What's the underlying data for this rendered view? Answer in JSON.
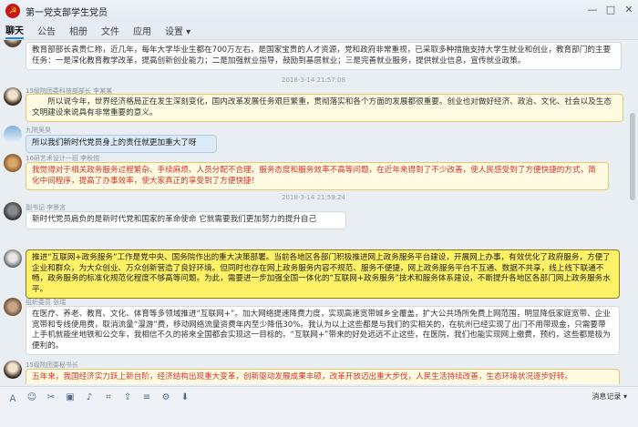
{
  "window": {
    "title": "第一党支部学生党员",
    "avatar_glyph": "☭",
    "controls": [
      "—",
      "□",
      "✕"
    ]
  },
  "tabs": [
    "聊天",
    "公告",
    "相册",
    "文件",
    "应用",
    "设置 ▾"
  ],
  "messages": [
    {
      "sender": "",
      "text": "教育部部长袁贵仁称，近几年，每年大学毕业生都在700万左右，是国家宝贵的人才资源，党和政府非常重视，已采取多种措施支持大学生就业和创业，教育部门的主要任务：一是深化教育教学改革，提高创新创业能力；二是加强就业指导，鼓励到基层就业；三是完善就业服务，提供就业信息，宣传就业政策。"
    },
    {
      "time": "2018-3-14 21:57:08"
    },
    {
      "sender": "15级院团委科技部部长 李某某",
      "text": "所以说今年，世界经济格局正在发生深刻变化，国内改革发展任务艰巨繁重，贯彻落实和各个方面的发展都很重要。创业也对做好经济、政治、文化、社会以及生态文明建设来说具有非常重要的意义。"
    },
    {
      "sender": "九院吴昊",
      "text": "所以我们新时代党员身上的责任就更加重大了呀"
    },
    {
      "sender": "16研艺术设计一班 李秋悦",
      "text": "我觉得对于相关政务服务过程繁杂、手续麻烦、人员分配不合理、服务态度和服务效率不高等问题，在近年来得到了不少改善，使人民感受到了方便快捷的方式，简化中间程序，提高了办事效率，使大家真正的享受到了方便快捷！"
    },
    {
      "time": "2018-3-14 21:59:24"
    },
    {
      "sender": "副书记 李景言",
      "text": "新时代党员肩负的是新时代党和国家的革命使命  它就需要我们更加努力的提升自己"
    },
    {
      "sender": "",
      "text": "推进“互联网+政务服务”工作是党中央、国务院作出的重大决策部署。当前各地区各部门积极推进网上政务服务平台建设，开展网上办事，有效优化了政府服务，方便了企业和群众，为大众创业、万众创新营造了良好环境。但同时也存在网上政务服务内容不规范、服务不便捷，网上政务服务平台不互通、数据不共享，线上线下联通不畅，政务服务的标准化规范化程度不够高等问题。为此，需要进一步加强全国一体化的“互联网+政务服务”技术和服务体系建设，不断提升各地区各部门网上政务服务水平。"
    },
    {
      "sender": "组织委员 张瑞",
      "text": "在医疗、养老、教育、文化、体育等多领域推进“互联网+”。加大网络提速降费力度，实现高速宽带城乡全覆盖，扩大公共场所免费上网范围，明显降低家庭宽带、企业宽带和专线使用费，取消流量“漫游”费，移动网络流量资费年内至少降低30%。我认为以上这些都是与我们的实相关的，在杭州已经实现了出门不用带现金，只需要带上手机就能坐地铁和公交车，我相信不久的将来全国都会实现这一目标的。“互联网+”带来的好处远远不止这些，在医院，我们也能实现网上缴费，预约，这些都是极为便利的。"
    },
    {
      "sender": "15级院团委秘书长",
      "text": "五年来，我国经济实力跃上新台阶，经济结构出现重大变革，创新驱动发展成果丰硕，改革开放迈出重大步伐，人民生活持续改善，生态环境状况逐步好转。"
    }
  ],
  "input": {
    "tools": [
      "Ａ",
      "☺",
      "✂",
      "▣",
      "♪",
      "⌗",
      "⇪",
      "≡",
      "⚙",
      "⬇"
    ],
    "history_label": "消息记录 ▾"
  }
}
